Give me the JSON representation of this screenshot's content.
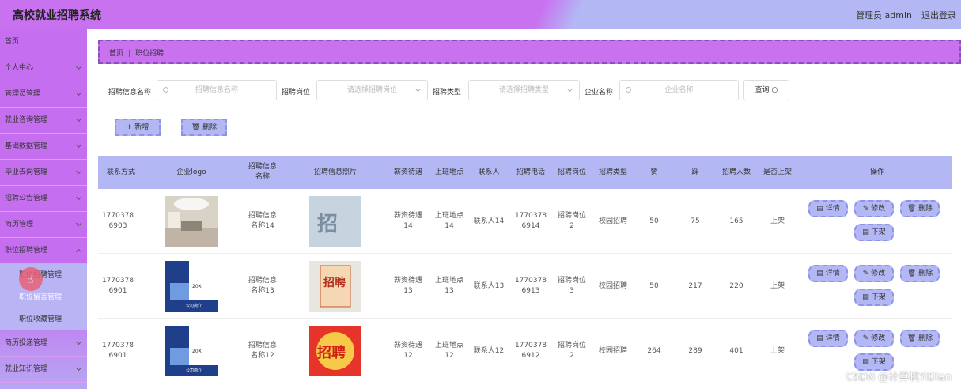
{
  "header": {
    "title": "高校就业招聘系统",
    "admin": "管理员 admin",
    "logout": "退出登录"
  },
  "sidebar": {
    "items": [
      {
        "label": "首页"
      },
      {
        "label": "个人中心"
      },
      {
        "label": "管理员管理"
      },
      {
        "label": "就业咨询管理"
      },
      {
        "label": "基础数据管理"
      },
      {
        "label": "毕业去向管理"
      },
      {
        "label": "招聘公告管理"
      },
      {
        "label": "简历管理"
      },
      {
        "label": "职位招聘管理"
      }
    ],
    "subitems": [
      {
        "label": "职位招聘管理"
      },
      {
        "label": "职位留言管理"
      },
      {
        "label": "职位收藏管理"
      }
    ],
    "after": [
      {
        "label": "简历投递管理"
      },
      {
        "label": "就业知识管理"
      }
    ]
  },
  "breadcrumb": {
    "home": "首页",
    "current": "职位招聘"
  },
  "search": {
    "name_label": "招聘信息名称",
    "name_placeholder": "招聘信息名称",
    "post_label": "招聘岗位",
    "post_placeholder": "请选择招聘岗位",
    "type_label": "招聘类型",
    "type_placeholder": "请选择招聘类型",
    "company_label": "企业名称",
    "company_placeholder": "企业名称",
    "query": "查询"
  },
  "actions": {
    "add": "+ 新增",
    "delete": "删除"
  },
  "table": {
    "headers": [
      "联系方式",
      "企业logo",
      "招聘信息名称",
      "招聘信息照片",
      "薪资待遇",
      "上班地点",
      "联系人",
      "招聘电话",
      "招聘岗位",
      "招聘类型",
      "赞",
      "踩",
      "招聘人数",
      "是否上架",
      "操作"
    ],
    "rows": [
      {
        "contact": "1770378\n6903",
        "name": "招聘信息\n名称14",
        "salary": "薪资待遇\n14",
        "place": "上班地点\n14",
        "person": "联系人14",
        "phone": "1770378\n6914",
        "post": "招聘岗位\n2",
        "type": "校园招聘",
        "zan": "50",
        "cai": "75",
        "num": "165",
        "shelf": "上架"
      },
      {
        "contact": "1770378\n6901",
        "name": "招聘信息\n名称13",
        "salary": "薪资待遇\n13",
        "place": "上班地点\n13",
        "person": "联系人13",
        "phone": "1770378\n6913",
        "post": "招聘岗位\n3",
        "type": "校园招聘",
        "zan": "50",
        "cai": "217",
        "num": "220",
        "shelf": "上架"
      },
      {
        "contact": "1770378\n6901",
        "name": "招聘信息\n名称12",
        "salary": "薪资待遇\n12",
        "place": "上班地点\n12",
        "person": "联系人12",
        "phone": "1770378\n6912",
        "post": "招聘岗位\n2",
        "type": "校园招聘",
        "zan": "264",
        "cai": "289",
        "num": "401",
        "shelf": "上架"
      }
    ],
    "ops": {
      "detail": "详情",
      "edit": "修改",
      "del": "删除",
      "off": "下架"
    }
  },
  "watermark": "CSDN @计算机YiDian"
}
